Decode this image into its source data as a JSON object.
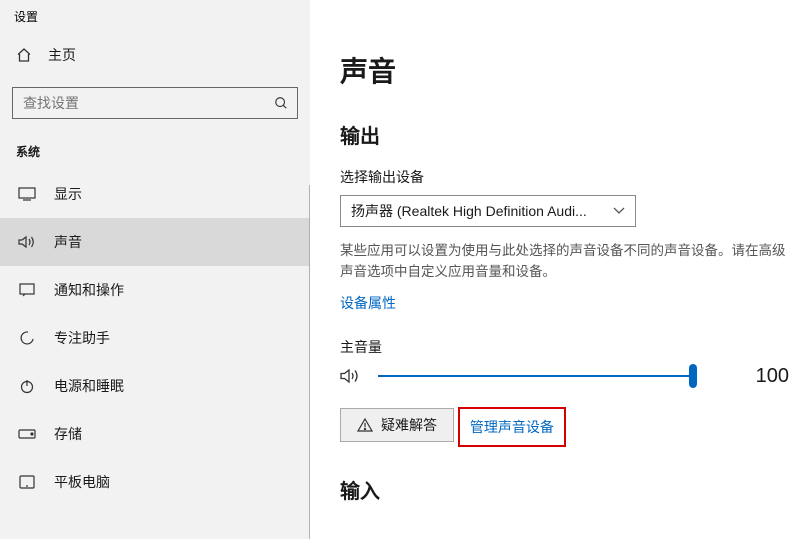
{
  "window": {
    "title": "设置"
  },
  "sidebar": {
    "home": "主页",
    "search_placeholder": "查找设置",
    "group": "系统",
    "items": [
      {
        "label": "显示",
        "icon": "display"
      },
      {
        "label": "声音",
        "icon": "sound",
        "selected": true
      },
      {
        "label": "通知和操作",
        "icon": "notifications"
      },
      {
        "label": "专注助手",
        "icon": "focus"
      },
      {
        "label": "电源和睡眠",
        "icon": "power"
      },
      {
        "label": "存储",
        "icon": "storage"
      },
      {
        "label": "平板电脑",
        "icon": "tablet"
      }
    ]
  },
  "main": {
    "page_title": "声音",
    "output_heading": "输出",
    "select_output_label": "选择输出设备",
    "output_device": "扬声器 (Realtek High Definition Audi...",
    "output_desc": "某些应用可以设置为使用与此处选择的声音设备不同的声音设备。请在高级声音选项中自定义应用音量和设备。",
    "device_properties": "设备属性",
    "master_volume_label": "主音量",
    "volume_value": "100",
    "troubleshoot": "疑难解答",
    "manage_devices": "管理声音设备",
    "input_heading": "输入"
  }
}
